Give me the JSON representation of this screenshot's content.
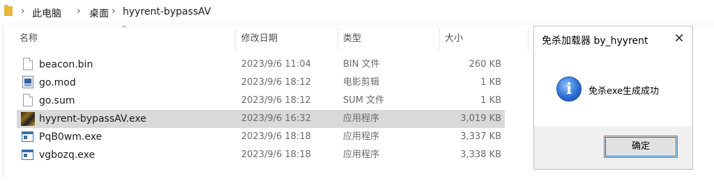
{
  "breadcrumb": {
    "items": [
      "此电脑",
      "桌面",
      "hyyrent-bypassAV"
    ]
  },
  "columns": {
    "name": "名称",
    "date": "修改日期",
    "type": "类型",
    "size": "大小"
  },
  "files": [
    {
      "name": "beacon.bin",
      "date": "2023/9/6 11:04",
      "type": "BIN 文件",
      "size": "260 KB",
      "icon": "document-icon"
    },
    {
      "name": "go.mod",
      "date": "2023/9/6 18:12",
      "type": "电影剪辑",
      "size": "1 KB",
      "icon": "media-file-icon"
    },
    {
      "name": "go.sum",
      "date": "2023/9/6 18:12",
      "type": "SUM 文件",
      "size": "1 KB",
      "icon": "document-icon"
    },
    {
      "name": "hyyrent-bypassAV.exe",
      "date": "2023/9/6 16:32",
      "type": "应用程序",
      "size": "3,019 KB",
      "icon": "app-image-icon",
      "selected": true
    },
    {
      "name": "PqB0wm.exe",
      "date": "2023/9/6 18:18",
      "type": "应用程序",
      "size": "3,337 KB",
      "icon": "exe-icon"
    },
    {
      "name": "vgbozq.exe",
      "date": "2023/9/6 18:18",
      "type": "应用程序",
      "size": "3,338 KB",
      "icon": "exe-icon"
    }
  ],
  "dialog": {
    "title": "免杀加载器 by_hyyrent",
    "close": "✕",
    "message": "免杀exe生成成功",
    "ok_label": "确定",
    "icon": "info-icon"
  }
}
